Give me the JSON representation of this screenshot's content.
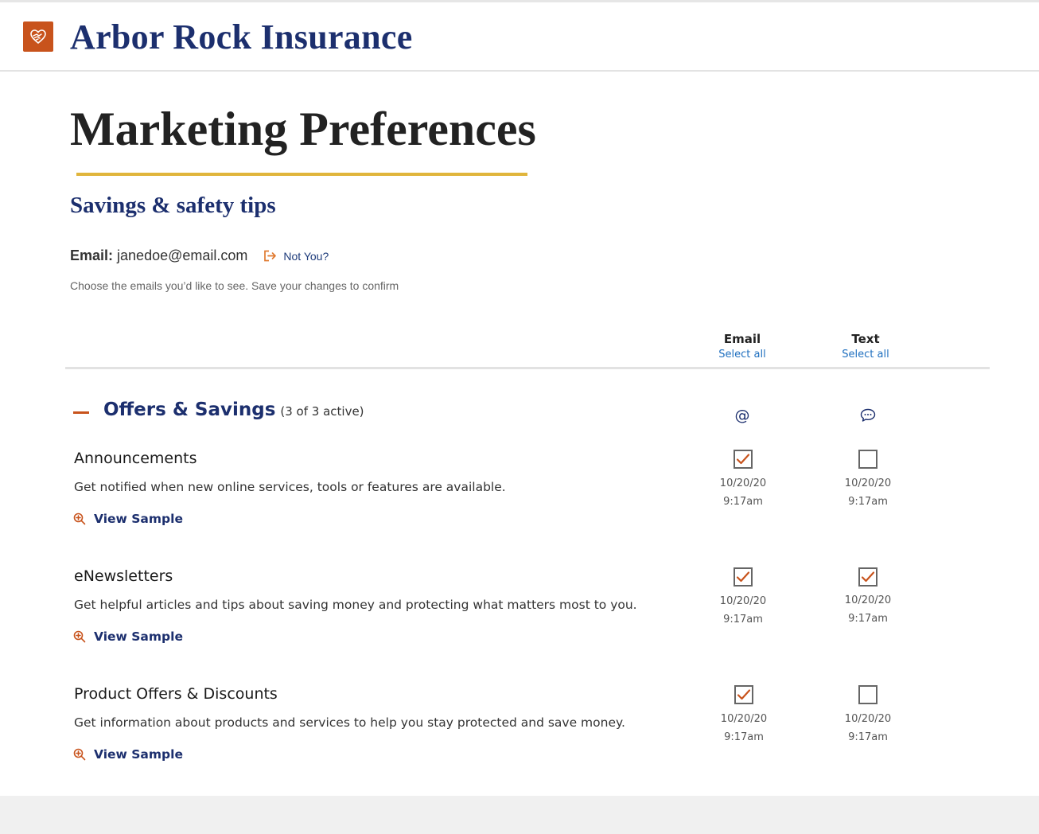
{
  "brand": {
    "name": "Arbor Rock Insurance",
    "logo_icon": "hands-heart-icon",
    "logo_color": "#c8531c"
  },
  "page": {
    "title": "Marketing Preferences",
    "subtitle": "Savings & safety tips",
    "email_label": "Email:",
    "email_value": "janedoe@email.com",
    "not_you": "Not You?",
    "instructions": "Choose the emails you’d like to see. Save your changes to confirm"
  },
  "columns": [
    {
      "label": "Email",
      "select_all": "Select all",
      "icon": "at-icon"
    },
    {
      "label": "Text",
      "select_all": "Select all",
      "icon": "chat-bubble-icon"
    }
  ],
  "section": {
    "title": "Offers & Savings",
    "count": "(3 of 3 active)",
    "expanded": true
  },
  "items": [
    {
      "title": "Announcements",
      "description": "Get notified when new online services, tools or features are available.",
      "view_sample": "View Sample",
      "email": {
        "checked": true,
        "date": "10/20/20",
        "time": "9:17am"
      },
      "text": {
        "checked": false,
        "date": "10/20/20",
        "time": "9:17am"
      }
    },
    {
      "title": "eNewsletters",
      "description": "Get helpful articles and tips about saving money and protecting what matters most to you.",
      "view_sample": "View Sample",
      "email": {
        "checked": true,
        "date": "10/20/20",
        "time": "9:17am"
      },
      "text": {
        "checked": true,
        "date": "10/20/20",
        "time": "9:17am"
      }
    },
    {
      "title": "Product Offers & Discounts",
      "description": "Get information about products and services to help you stay protected and save money.",
      "view_sample": "View Sample",
      "email": {
        "checked": true,
        "date": "10/20/20",
        "time": "9:17am"
      },
      "text": {
        "checked": false,
        "date": "10/20/20",
        "time": "9:17am"
      }
    }
  ],
  "colors": {
    "navy": "#1c2f6e",
    "orange": "#c8531c",
    "gold": "#e0b53c",
    "link_blue": "#1f6fbf"
  }
}
